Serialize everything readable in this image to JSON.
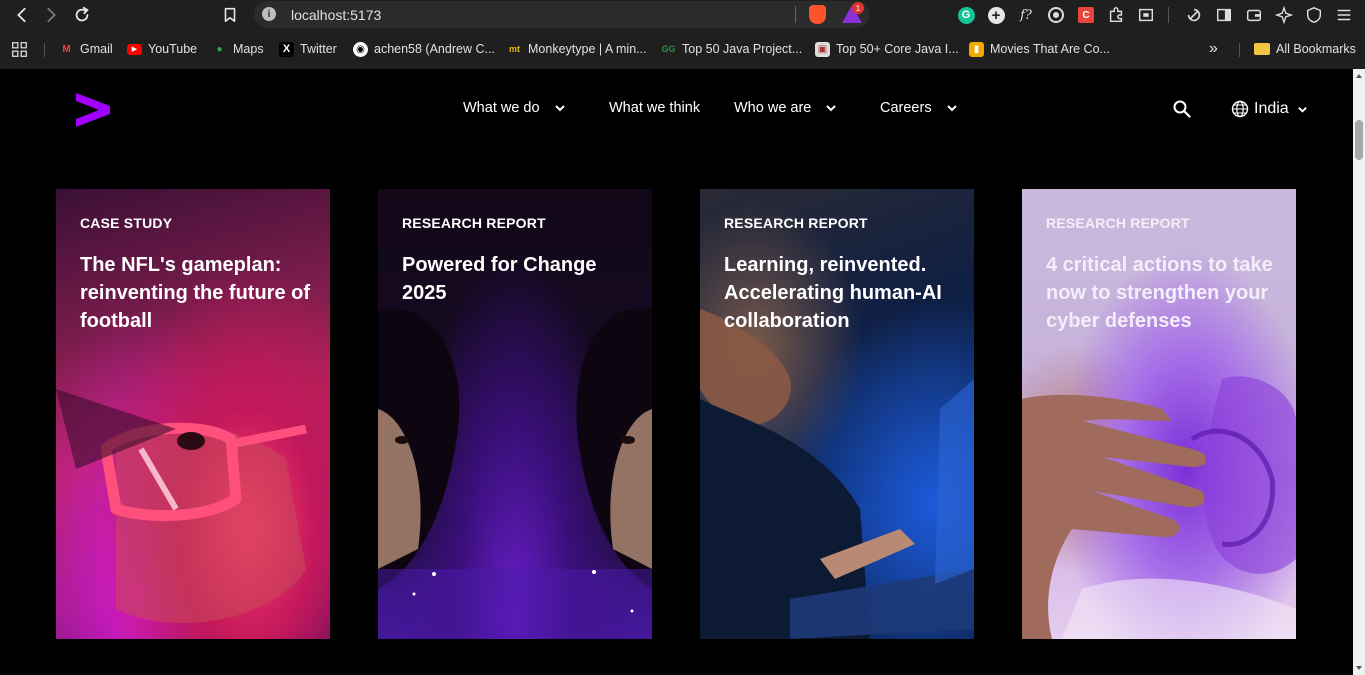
{
  "browser": {
    "url": "localhost:5173",
    "bookmarks": [
      {
        "label": "Gmail",
        "icon": "gmail-icon"
      },
      {
        "label": "YouTube",
        "icon": "youtube-icon"
      },
      {
        "label": "Maps",
        "icon": "maps-icon"
      },
      {
        "label": "Twitter",
        "icon": "x-icon"
      },
      {
        "label": "achen58 (Andrew C...",
        "icon": "github-icon"
      },
      {
        "label": "Monkeytype | A min...",
        "icon": "monkeytype-icon"
      },
      {
        "label": "Top 50 Java Project...",
        "icon": "geeksforgeeks-icon"
      },
      {
        "label": "Top 50+ Core Java I...",
        "icon": "bookmark-site-icon"
      },
      {
        "label": "Movies That Are Co...",
        "icon": "bookmark-site-icon"
      }
    ],
    "all_bookmarks": "All Bookmarks",
    "notification_count": "1"
  },
  "header": {
    "nav": [
      {
        "label": "What we do",
        "has_menu": true
      },
      {
        "label": "What we think",
        "has_menu": false
      },
      {
        "label": "Who we are",
        "has_menu": true
      },
      {
        "label": "Careers",
        "has_menu": true
      }
    ],
    "language": "India"
  },
  "cards": [
    {
      "tag": "CASE STUDY",
      "title": "The NFL's gameplan: reinventing the future of football"
    },
    {
      "tag": "RESEARCH REPORT",
      "title": "Powered for Change 2025"
    },
    {
      "tag": "RESEARCH REPORT",
      "title": "Learning, reinvented. Accelerating human-AI collaboration"
    },
    {
      "tag": "RESEARCH REPORT",
      "title": "4 critical actions to take now to strengthen your cyber defenses"
    }
  ],
  "colors": {
    "brand": "#a100ff",
    "background": "#000000"
  }
}
